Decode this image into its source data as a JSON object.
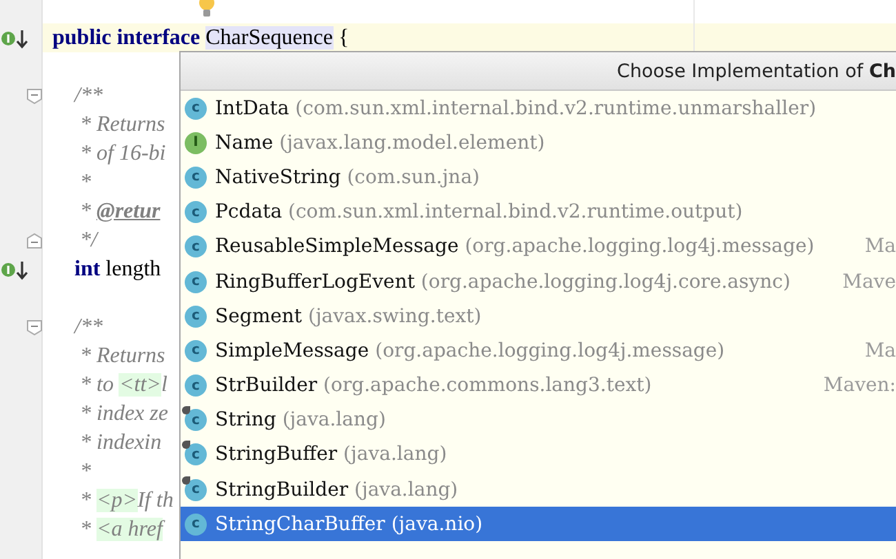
{
  "editor": {
    "lines": [
      {
        "kind": "code",
        "intention": true
      },
      {
        "kind": "code",
        "implemented": true,
        "current": true,
        "segments": [
          {
            "kind": "keyword",
            "text": "public interface "
          },
          {
            "kind": "highlight",
            "text": "CharSequence"
          },
          {
            "kind": "plain",
            "text": " {"
          }
        ]
      },
      {
        "kind": "blank"
      },
      {
        "kind": "code",
        "fold_start": true,
        "segments": [
          {
            "kind": "comment",
            "text": "    /**"
          }
        ]
      },
      {
        "kind": "code",
        "segments": [
          {
            "kind": "comment",
            "text": "     * Returns"
          }
        ]
      },
      {
        "kind": "code",
        "segments": [
          {
            "kind": "comment",
            "text": "     * of 16-bi"
          }
        ]
      },
      {
        "kind": "code",
        "segments": [
          {
            "kind": "comment",
            "text": "     *"
          }
        ]
      },
      {
        "kind": "code",
        "segments": [
          {
            "kind": "comment",
            "text": "     * "
          },
          {
            "kind": "doc-tag",
            "text": "@retur"
          }
        ]
      },
      {
        "kind": "code",
        "fold_end": true,
        "segments": [
          {
            "kind": "comment",
            "text": "     */"
          }
        ]
      },
      {
        "kind": "code",
        "implemented": true,
        "segments": [
          {
            "kind": "keyword",
            "text": "    int"
          },
          {
            "kind": "plain",
            "text": " length"
          }
        ]
      },
      {
        "kind": "blank"
      },
      {
        "kind": "code",
        "fold_start": true,
        "segments": [
          {
            "kind": "comment",
            "text": "    /**"
          }
        ]
      },
      {
        "kind": "code",
        "segments": [
          {
            "kind": "comment",
            "text": "     * Returns"
          }
        ]
      },
      {
        "kind": "code",
        "segments": [
          {
            "kind": "comment",
            "text": "     * to "
          },
          {
            "kind": "html-tag",
            "text": "<tt>"
          },
          {
            "kind": "comment",
            "text": "l"
          }
        ]
      },
      {
        "kind": "code",
        "segments": [
          {
            "kind": "comment",
            "text": "     * index ze"
          }
        ]
      },
      {
        "kind": "code",
        "segments": [
          {
            "kind": "comment",
            "text": "     * indexin"
          }
        ]
      },
      {
        "kind": "code",
        "segments": [
          {
            "kind": "comment",
            "text": "     *"
          }
        ]
      },
      {
        "kind": "code",
        "segments": [
          {
            "kind": "comment",
            "text": "     * "
          },
          {
            "kind": "html-tag",
            "text": "<p>"
          },
          {
            "kind": "comment",
            "text": "If th"
          }
        ]
      },
      {
        "kind": "code",
        "segments": [
          {
            "kind": "comment",
            "text": "     * "
          },
          {
            "kind": "html-tag",
            "text": "<a href"
          }
        ]
      }
    ]
  },
  "popup": {
    "title": "Choose Implementation of **Ch**",
    "items": [
      {
        "kind": "class",
        "badge": "c",
        "final": false,
        "selected": false,
        "name": "IntData",
        "package": "(com.sun.xml.internal.bind.v2.runtime.unmarshaller)"
      },
      {
        "kind": "interface",
        "badge": "I",
        "final": false,
        "selected": false,
        "name": "Name",
        "package": "(javax.lang.model.element)"
      },
      {
        "kind": "class",
        "badge": "c",
        "final": false,
        "selected": false,
        "name": "NativeString",
        "package": "(com.sun.jna)"
      },
      {
        "kind": "class",
        "badge": "c",
        "final": false,
        "selected": false,
        "name": "Pcdata",
        "package": "(com.sun.xml.internal.bind.v2.runtime.output)"
      },
      {
        "kind": "class",
        "badge": "c",
        "final": false,
        "selected": false,
        "name": "ReusableSimpleMessage",
        "package": "(org.apache.logging.log4j.message)",
        "location": "Ma"
      },
      {
        "kind": "class",
        "badge": "c",
        "final": false,
        "selected": false,
        "name": "RingBufferLogEvent",
        "package": "(org.apache.logging.log4j.core.async)",
        "location": "Mave"
      },
      {
        "kind": "class",
        "badge": "c",
        "final": false,
        "selected": false,
        "name": "Segment",
        "package": "(javax.swing.text)"
      },
      {
        "kind": "class",
        "badge": "c",
        "final": false,
        "selected": false,
        "name": "SimpleMessage",
        "package": "(org.apache.logging.log4j.message)",
        "location": "Ma"
      },
      {
        "kind": "class",
        "badge": "c",
        "final": false,
        "selected": false,
        "name": "StrBuilder",
        "package": "(org.apache.commons.lang3.text)",
        "location": "Maven:"
      },
      {
        "kind": "class",
        "badge": "c",
        "final": true,
        "selected": false,
        "name": "String",
        "package": "(java.lang)"
      },
      {
        "kind": "class",
        "badge": "c",
        "final": true,
        "selected": false,
        "name": "StringBuffer",
        "package": "(java.lang)"
      },
      {
        "kind": "class",
        "badge": "c",
        "final": true,
        "selected": false,
        "name": "StringBuilder",
        "package": "(java.lang)"
      },
      {
        "kind": "class",
        "badge": "c",
        "final": false,
        "selected": true,
        "name": "StringCharBuffer",
        "package": "(java.nio)"
      }
    ]
  }
}
